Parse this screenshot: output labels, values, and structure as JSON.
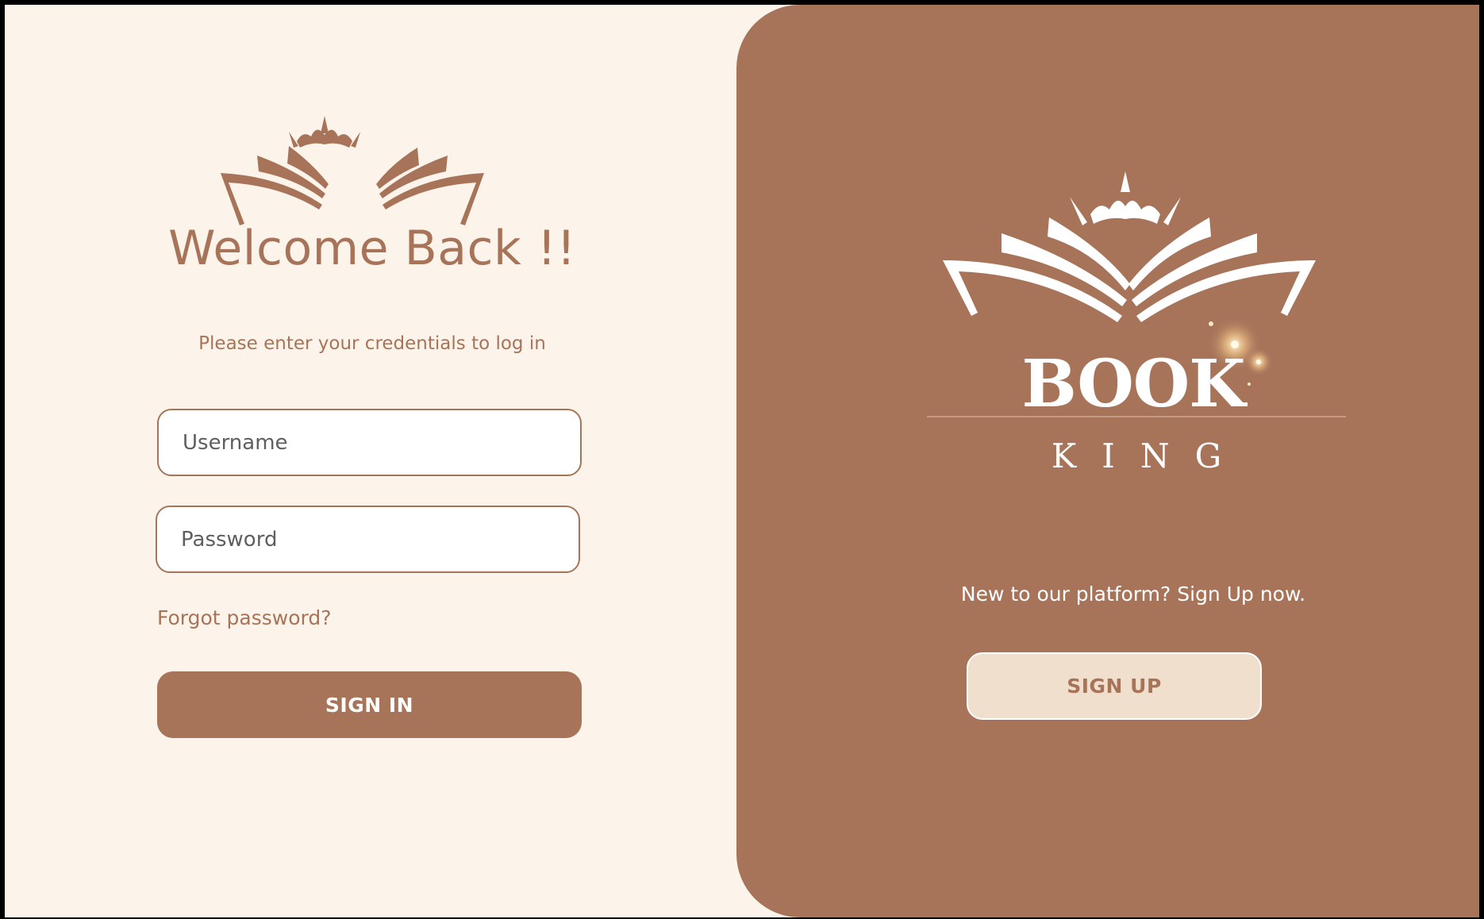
{
  "colors": {
    "accent": "#a87459",
    "background": "#fcf4ea",
    "panel": "#a7745a",
    "signup_button": "#f1dfce"
  },
  "login": {
    "title": "Welcome Back !!",
    "subtitle": "Please enter your credentials to log in",
    "username_placeholder": "Username",
    "password_placeholder": "Password",
    "forgot_label": "Forgot password?",
    "signin_label": "SIGN IN",
    "logo_icon": "book-crown-logo-icon"
  },
  "brand": {
    "name_line1": "BOOK",
    "name_line2": "KING",
    "logo_icon": "book-crown-logo-icon",
    "cta_text": "New to our platform? Sign Up now.",
    "signup_label": "SIGN UP"
  }
}
